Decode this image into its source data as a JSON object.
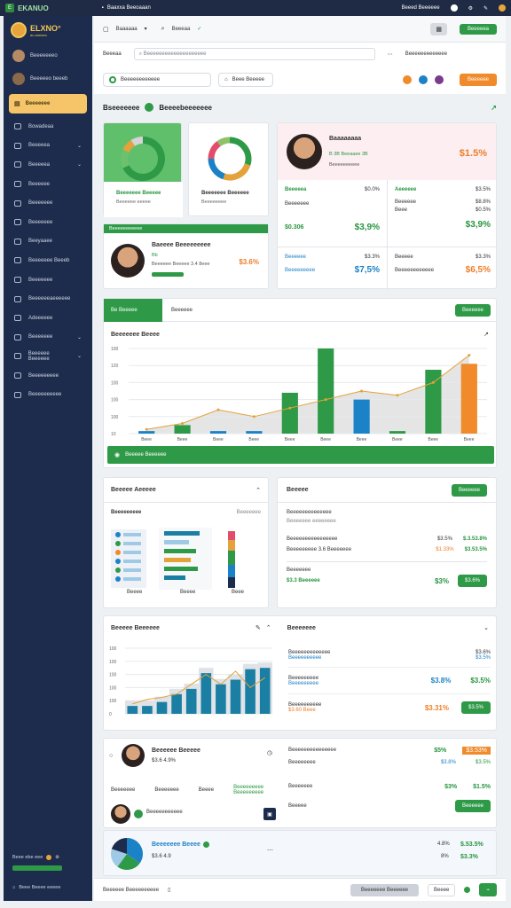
{
  "topbar": {
    "logo": "E",
    "brand": "EKANUO",
    "menu": "Baaxxa Beeoaaan",
    "right_text": "Beeed Beeeeee"
  },
  "sidebar": {
    "logo_name": "ELXNO°",
    "logo_sub": "au aoeaeo",
    "user": "Beeeeeeeo",
    "user2": "Beeeeeo beeeb",
    "active": "Beeeeeee",
    "items": [
      {
        "label": "Bowadeaa",
        "chev": false
      },
      {
        "label": "Beeeeea",
        "chev": true
      },
      {
        "label": "Beeeeea",
        "chev": true
      },
      {
        "label": "Beeeeee",
        "chev": false
      },
      {
        "label": "Beeeeeee",
        "chev": false
      },
      {
        "label": "Beeeeeee",
        "chev": false
      },
      {
        "label": "Beeyaaee",
        "chev": false
      },
      {
        "label": "Beeeeeee Beeeb",
        "chev": false
      },
      {
        "label": "Beeeeeee",
        "chev": false
      },
      {
        "label": "Beeeeeeaeeeeee",
        "chev": false
      },
      {
        "label": "Adeeeeee",
        "chev": false
      },
      {
        "label": "Beeeeeee",
        "chev": true
      },
      {
        "label": "Beeeeee Beeeeee",
        "chev": true
      },
      {
        "label": "Beeeeeeeee",
        "chev": false
      },
      {
        "label": "Beeeeeeeeee",
        "chev": false
      }
    ],
    "foot_text": "Beee ebe eee",
    "foot_bottom": "Beee Beeee eeeee"
  },
  "header": {
    "title": "Baaaaaa",
    "menu": "Beeeaa",
    "action": "Beeeeea",
    "filter": "Beeeaa",
    "search_placeholder": "Beeeeeeeeeeeeeeeeeeee",
    "right": "Beeeeeeeeeeeee",
    "pill1": "Beeeeeeeeeeee",
    "pill2": "Beee Beeeee",
    "cta": "Beeeeee"
  },
  "section": {
    "title": "Bseeeeeee",
    "title2": "Beeeebeeeeeee"
  },
  "donut1": {
    "label": "Beeeeeee Beeeee",
    "sub": "Beeeeee eeeee",
    "segments": [
      0.68,
      0.14,
      0.09,
      0.09
    ],
    "colors": [
      "#2e9a47",
      "#6cc16f",
      "#e3a23a",
      "#d4d4d4"
    ]
  },
  "donut2": {
    "label": "Beeeeeee Beeeeee",
    "sub": "Beeeeeeee",
    "segments": [
      0.3,
      0.25,
      0.2,
      0.15,
      0.1
    ],
    "colors": [
      "#2e9a47",
      "#e3a23a",
      "#1c82c7",
      "#e34c6a",
      "#8fc16a"
    ]
  },
  "profile_card": {
    "header": "Beeeeeeeeeee",
    "name": "Baeeee Beeeeeeeee",
    "line2": "Bb",
    "line3": "Beeeeee Beeeee 3.4 8eee",
    "value": "$3.6%"
  },
  "kpi_card": {
    "name": "Baaaaaaaa",
    "info": "B 3B Beeaaee 3B",
    "info2": "Beeeeeeeeee",
    "value": "$1.5%",
    "cells": [
      {
        "l1": "Beeeeea",
        "v1": "$0.0%",
        "l2": "Beeeeeee",
        "v2": "",
        "big1": "$0.306",
        "big2": "$3,9%"
      },
      {
        "l1": "Aeeeeee",
        "v1": "$3.5%",
        "l2": "Beeeeee",
        "v2": "$8.8%",
        "l3": "Beee",
        "v3": "$0.5%",
        "big2": "$3,9%"
      },
      {
        "l1": "Beeeeee",
        "v1": "$3.3%",
        "l2": "Beeeeeeeee",
        "big2": "$7,5%"
      },
      {
        "l1": "Beeeee",
        "v1": "$3.3%",
        "l2": "Beeeeeeeeeeee",
        "v2": "",
        "big2": "$6,5%"
      }
    ]
  },
  "tabs": {
    "active": "Be Beeeee",
    "other": "Beeeeee",
    "button": "Beeeeee"
  },
  "chart_data": {
    "type": "bar",
    "title": "Beeeeeee Beeee",
    "yticks": [
      "100",
      "120",
      "100",
      "100",
      "100",
      "10"
    ],
    "categories": [
      "Beee",
      "Beee",
      "Beee",
      "Beee",
      "Beee",
      "Beee",
      "Beee",
      "Beee",
      "Beee",
      "Beee"
    ],
    "values": [
      3,
      10,
      3,
      3,
      48,
      100,
      40,
      3,
      75,
      82
    ],
    "colors": [
      "#1c82c7",
      "#2e9a47",
      "#1c82c7",
      "#1c82c7",
      "#2e9a47",
      "#2e9a47",
      "#1c82c7",
      "#2e9a47",
      "#2e9a47",
      "#f08a2a"
    ],
    "line": [
      5,
      12,
      28,
      20,
      30,
      40,
      50,
      45,
      60,
      92
    ],
    "footer": "Beeeee Beeeeee"
  },
  "mini_panel": {
    "title": "Beeeee Aeeeee",
    "sub": "Beeeeeeeee",
    "subright": "Beeeeeee",
    "labels": [
      "Beeee",
      "Beeee",
      "Beee"
    ]
  },
  "booking": {
    "title": "Beeeee",
    "button": "Beeeeee",
    "row0": "Beeeeeeeeeeeeee",
    "row0b": "Beeeeeee eeeeeeee",
    "rows": [
      {
        "label": "Beeeeeeeeeeeeeeee",
        "v1": "$3.5%",
        "v2": "$.3.53.8%"
      },
      {
        "label": "Beeeeeeeee 3.6 Beeeeeee",
        "v1": "$1.33%",
        "v2": "$3.53.5%"
      }
    ],
    "footer_label": "Beeeeeee",
    "footer_value": "$3.3 Beeeeee",
    "footer_right": "$3%",
    "footer_btn": "$3.6%"
  },
  "bottom_chart": {
    "title": "Beeeee Beeeeee",
    "yticks": [
      "100",
      "100",
      "100",
      "100",
      "100",
      "0"
    ],
    "values": [
      12,
      12,
      18,
      30,
      38,
      62,
      45,
      52,
      68,
      70
    ],
    "line": [
      15,
      22,
      25,
      30,
      45,
      60,
      45,
      65,
      40,
      55
    ]
  },
  "forecast": {
    "title": "Beeeeeee",
    "rows": [
      {
        "l1": "Beeeeeeeeeeeee",
        "l2": "Beeeeeeeeee",
        "v1": "$3.6%",
        "v2": "$3.5%"
      },
      {
        "l1": "Beeeeeeeee",
        "l2": "Beeeeeeeee",
        "v1": "$3.8%",
        "v2": "$3.5%"
      },
      {
        "l1": "Beeeeeeeeee",
        "l2": "$3.60 Beee",
        "v1": "$3.31%",
        "v2": "$3.5%"
      }
    ]
  },
  "contact": {
    "name": "Beeeeee Beeeee",
    "sub": "$3.6 4.9%",
    "tabs": [
      "Beeeeeee",
      "Beeeeeee",
      "Beeee",
      "Beeeeeeeee Beeeeeeeee"
    ],
    "person2": "Beeeeeeeeeee",
    "right_rows": [
      {
        "label": "Beeeeeeeeeeeeeee",
        "v1": "$5%",
        "v2": "$3.53%"
      },
      {
        "label": "Beeeeeeee",
        "v1": "$3.8%",
        "v2": "$3.5%"
      },
      {
        "label": "Beeeeeee",
        "v1": "$3%",
        "v2": "$1.5%"
      }
    ],
    "row_btn": "Beeeeee"
  },
  "pie_panel": {
    "name": "Beeeeeee Beeee",
    "sub": "$3.6 4.9",
    "v1": "4.8%",
    "v2": "$.53.5%",
    "v3": "8%",
    "v4": "$3.3%",
    "segments": [
      0.35,
      0.25,
      0.2,
      0.2
    ],
    "colors": [
      "#1c82c7",
      "#2e9a47",
      "#9ecae8",
      "#1d2c4c"
    ]
  },
  "footerbar": {
    "left": "Beeeeee Beeeeeeeeee",
    "btn1": "Beeeeeee Beeeeee",
    "btn2": "Beeee"
  }
}
